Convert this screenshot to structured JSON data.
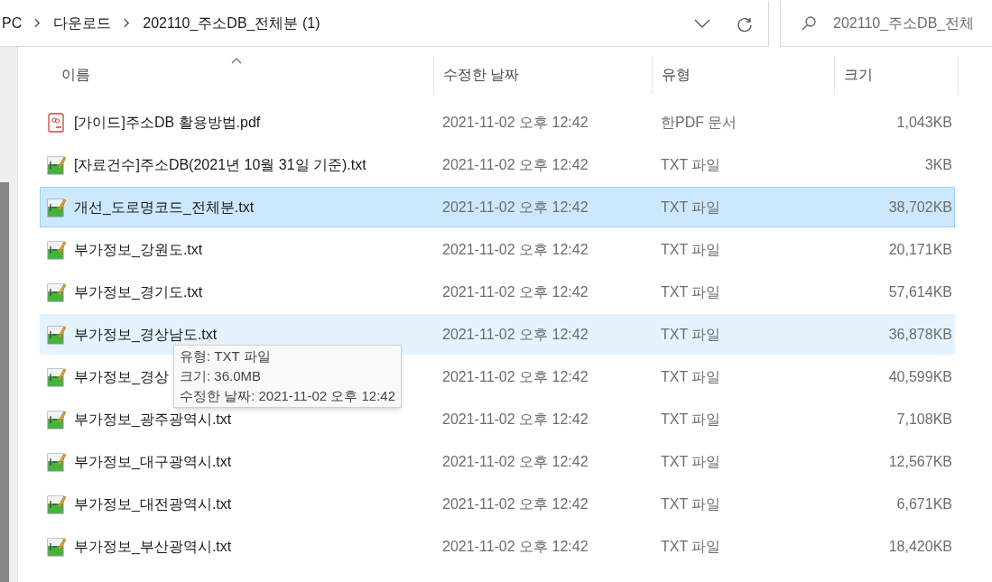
{
  "address_bar": {
    "path": [
      "PC",
      "다운로드",
      "202110_주소DB_전체분 (1)"
    ]
  },
  "search": {
    "placeholder": "202110_주소DB_전체"
  },
  "columns": [
    {
      "label": "이름",
      "sorted": true
    },
    {
      "label": "수정한 날짜",
      "sorted": false
    },
    {
      "label": "유형",
      "sorted": false
    },
    {
      "label": "크기",
      "sorted": false
    }
  ],
  "rows": [
    {
      "kind": "pdf",
      "name": "[가이드]주소DB 활용방법.pdf",
      "date": "2021-11-02 오후 12:42",
      "type": "한PDF 문서",
      "size": "1,043KB",
      "selected": false,
      "hovered": false
    },
    {
      "kind": "txt",
      "name": "[자료건수]주소DB(2021년 10월 31일 기준).txt",
      "date": "2021-11-02 오후 12:42",
      "type": "TXT 파일",
      "size": "3KB",
      "selected": false,
      "hovered": false
    },
    {
      "kind": "txt",
      "name": "개선_도로명코드_전체분.txt",
      "date": "2021-11-02 오후 12:42",
      "type": "TXT 파일",
      "size": "38,702KB",
      "selected": true,
      "hovered": false
    },
    {
      "kind": "txt",
      "name": "부가정보_강원도.txt",
      "date": "2021-11-02 오후 12:42",
      "type": "TXT 파일",
      "size": "20,171KB",
      "selected": false,
      "hovered": false
    },
    {
      "kind": "txt",
      "name": "부가정보_경기도.txt",
      "date": "2021-11-02 오후 12:42",
      "type": "TXT 파일",
      "size": "57,614KB",
      "selected": false,
      "hovered": false
    },
    {
      "kind": "txt",
      "name": "부가정보_경상남도.txt",
      "date": "2021-11-02 오후 12:42",
      "type": "TXT 파일",
      "size": "36,878KB",
      "selected": false,
      "hovered": true
    },
    {
      "kind": "txt",
      "name": "부가정보_경상",
      "date": "2021-11-02 오후 12:42",
      "type": "TXT 파일",
      "size": "40,599KB",
      "selected": false,
      "hovered": false
    },
    {
      "kind": "txt",
      "name": "부가정보_광주광역시.txt",
      "date": "2021-11-02 오후 12:42",
      "type": "TXT 파일",
      "size": "7,108KB",
      "selected": false,
      "hovered": false
    },
    {
      "kind": "txt",
      "name": "부가정보_대구광역시.txt",
      "date": "2021-11-02 오후 12:42",
      "type": "TXT 파일",
      "size": "12,567KB",
      "selected": false,
      "hovered": false
    },
    {
      "kind": "txt",
      "name": "부가정보_대전광역시.txt",
      "date": "2021-11-02 오후 12:42",
      "type": "TXT 파일",
      "size": "6,671KB",
      "selected": false,
      "hovered": false
    },
    {
      "kind": "txt",
      "name": "부가정보_부산광역시.txt",
      "date": "2021-11-02 오후 12:42",
      "type": "TXT 파일",
      "size": "18,420KB",
      "selected": false,
      "hovered": false
    }
  ],
  "tooltip": {
    "lines": [
      "유형: TXT 파일",
      "크기: 36.0MB",
      "수정한 날짜: 2021-11-02 오후 12:42"
    ]
  }
}
